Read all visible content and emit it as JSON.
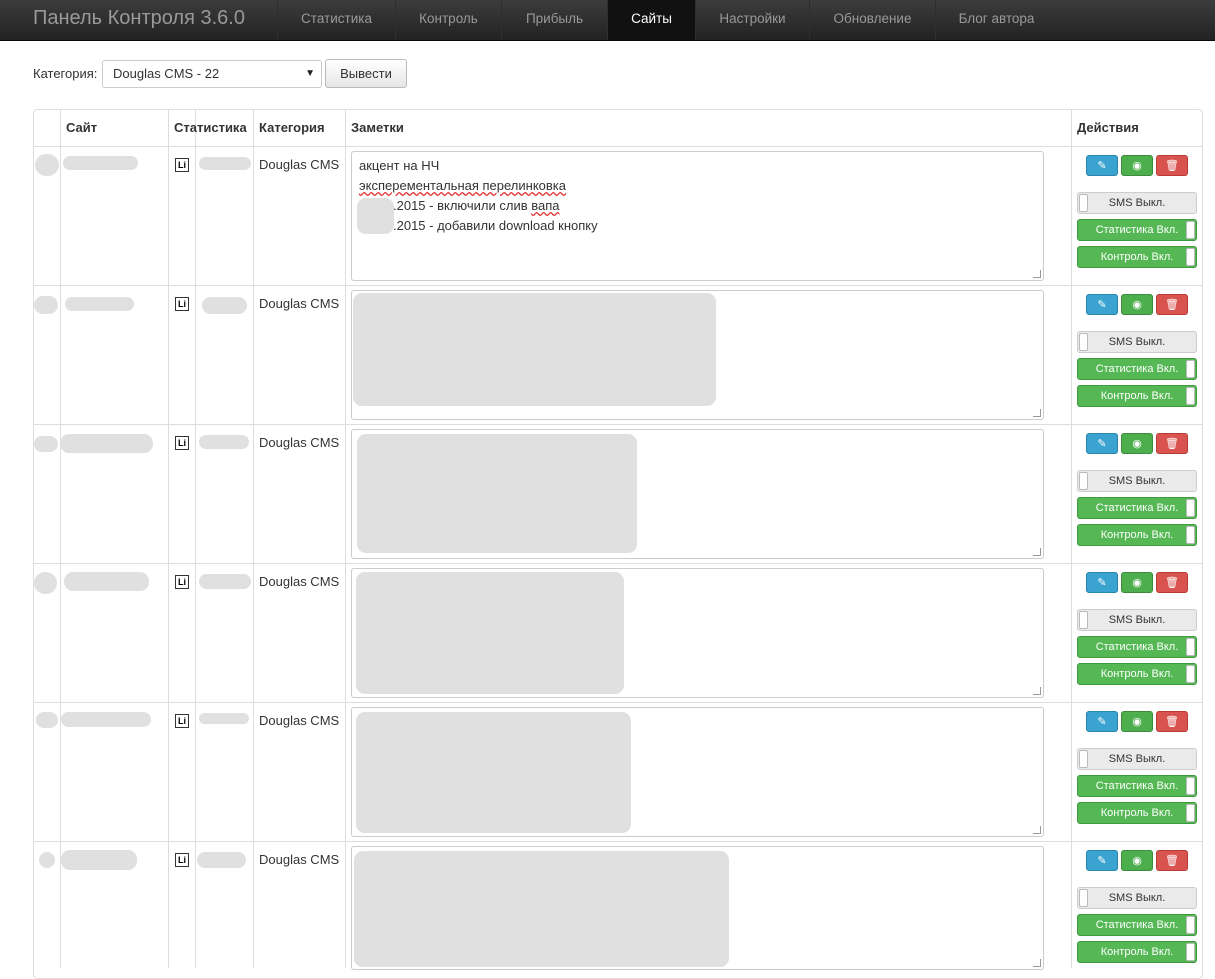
{
  "app": {
    "title": "Панель Контроля 3.6.0"
  },
  "nav": {
    "stats": "Статистика",
    "control": "Контроль",
    "profit": "Прибыль",
    "sites": "Сайты",
    "settings": "Настройки",
    "update": "Обновление",
    "blog": "Блог автора"
  },
  "filter": {
    "label": "Категория:",
    "selected": "Douglas CMS - 22",
    "submit": "Вывести"
  },
  "table": {
    "headers": {
      "site": "Сайт",
      "stats": "Статистика",
      "category": "Категория",
      "notes": "Заметки",
      "actions": "Действия"
    },
    "stats_icon_text": "Li",
    "rows": [
      {
        "category": "Douglas CMS",
        "notes": [
          "акцент на НЧ",
          "эксперементальная перелинковка",
          ".2015 - включили слив",
          "вапа",
          ".2015 - добавили download кнопку"
        ],
        "sms": "SMS Выкл.",
        "stats_toggle": "Статистика Вкл.",
        "control_toggle": "Контроль Вкл."
      },
      {
        "category": "Douglas CMS",
        "sms": "SMS Выкл.",
        "stats_toggle": "Статистика Вкл.",
        "control_toggle": "Контроль Вкл."
      },
      {
        "category": "Douglas CMS",
        "sms": "SMS Выкл.",
        "stats_toggle": "Статистика Вкл.",
        "control_toggle": "Контроль Вкл."
      },
      {
        "category": "Douglas CMS",
        "sms": "SMS Выкл.",
        "stats_toggle": "Статистика Вкл.",
        "control_toggle": "Контроль Вкл."
      },
      {
        "category": "Douglas CMS",
        "sms": "SMS Выкл.",
        "stats_toggle": "Статистика Вкл.",
        "control_toggle": "Контроль Вкл."
      },
      {
        "category": "Douglas CMS",
        "sms": "SMS Выкл.",
        "stats_toggle": "Статистика Вкл.",
        "control_toggle": "Контроль Вкл."
      }
    ]
  },
  "icons": {
    "edit": "pencil-icon",
    "view": "eye-icon",
    "delete": "trash-icon"
  },
  "colors": {
    "navbar": "#222222",
    "edit": "#3aa3cf",
    "view": "#4cae4c",
    "delete": "#d9534f",
    "toggle_on": "#55b855"
  }
}
